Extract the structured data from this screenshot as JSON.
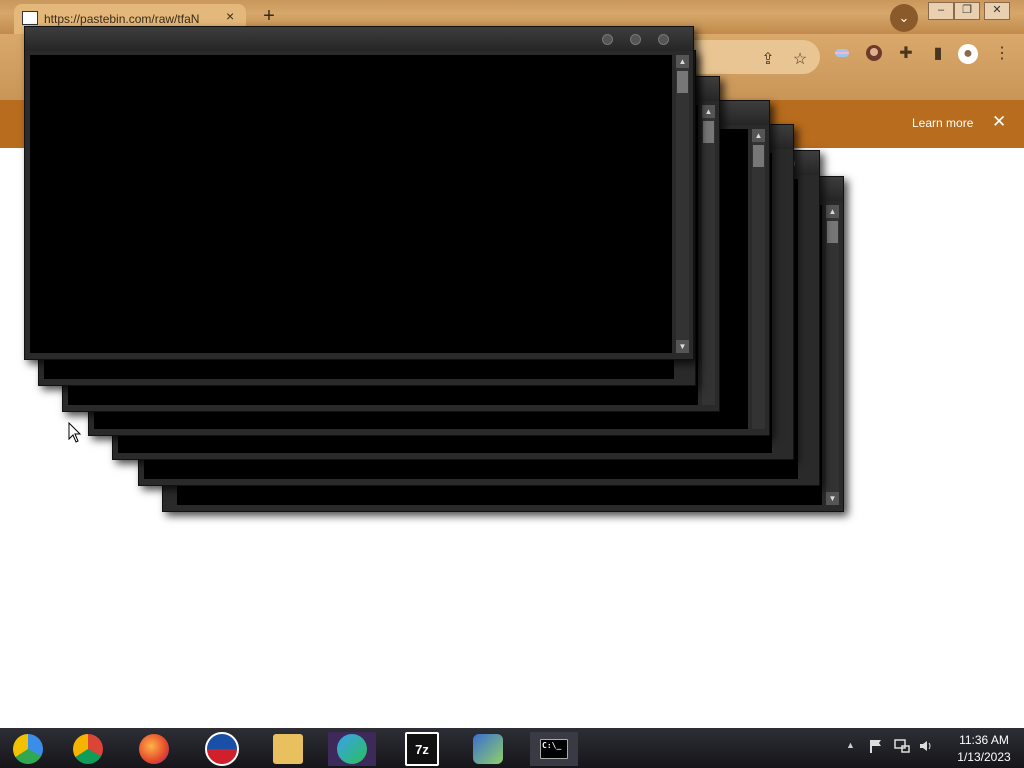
{
  "browser": {
    "tab_title": "https://pastebin.com/raw/tfaN",
    "tab_close": "×",
    "new_tab": "+",
    "tab_search": "⌄",
    "win_minimize": "–",
    "win_restore": "❐",
    "win_close": "✕"
  },
  "toolbar": {
    "share": "⇪",
    "bookmark": "☆",
    "extensions": "✚",
    "sidepanel": "▮",
    "profile": "●",
    "menu": "⋮"
  },
  "infobar": {
    "learn_more": "Learn more",
    "close": "✕"
  },
  "console_windows": {
    "scroll_up": "▲",
    "scroll_down": "▼"
  },
  "taskbar": {
    "apps": [
      {
        "icon": "chromium-icon",
        "label": ""
      },
      {
        "icon": "chrome-icon",
        "label": ""
      },
      {
        "icon": "firefox-icon",
        "label": ""
      },
      {
        "icon": "obama-icon",
        "label": ""
      },
      {
        "icon": "file-explorer-icon",
        "label": ""
      },
      {
        "icon": "messenger-icon",
        "label": ""
      },
      {
        "icon": "7zip-icon",
        "label": "7z"
      },
      {
        "icon": "installer-icon",
        "label": ""
      },
      {
        "icon": "cmd-icon",
        "label": "C:\\_"
      }
    ],
    "tray_arrow": "▲",
    "time": "11:36 AM",
    "date": "1/13/2023"
  },
  "colors": {
    "console_bg": "#000000",
    "console_frame": "#2a2a2a",
    "infobar": "#b86c1e"
  }
}
